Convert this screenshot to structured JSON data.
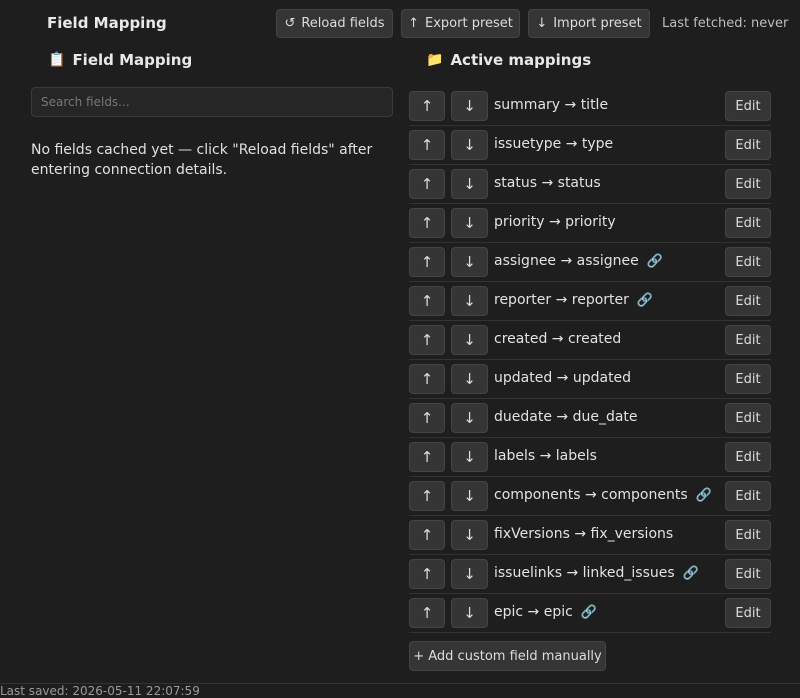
{
  "toolbar": {
    "title": "Field Mapping",
    "reload": {
      "icon": "↺",
      "label": "Reload fields"
    },
    "export": {
      "icon": "↑",
      "label": "Export preset"
    },
    "import": {
      "icon": "↓",
      "label": "Import preset"
    },
    "last_fetched": "Last fetched: never"
  },
  "left": {
    "icon": "📋",
    "title": "Field Mapping",
    "search_placeholder": "Search fields...",
    "empty_message": "No fields cached yet — click \"Reload fields\" after entering connection details."
  },
  "right": {
    "icon": "📁",
    "title": "Active mappings",
    "up_label": "↑",
    "down_label": "↓",
    "edit_label": "Edit",
    "link_icon": "🔗",
    "mappings": [
      {
        "label": "summary → title",
        "linked": false
      },
      {
        "label": "issuetype → type",
        "linked": false
      },
      {
        "label": "status → status",
        "linked": false
      },
      {
        "label": "priority → priority",
        "linked": false
      },
      {
        "label": "assignee → assignee",
        "linked": true
      },
      {
        "label": "reporter → reporter",
        "linked": true
      },
      {
        "label": "created → created",
        "linked": false
      },
      {
        "label": "updated → updated",
        "linked": false
      },
      {
        "label": "duedate → due_date",
        "linked": false
      },
      {
        "label": "labels → labels",
        "linked": false
      },
      {
        "label": "components → components",
        "linked": true
      },
      {
        "label": "fixVersions → fix_versions",
        "linked": false
      },
      {
        "label": "issuelinks → linked_issues",
        "linked": true
      },
      {
        "label": "epic → epic",
        "linked": true
      }
    ],
    "add_label": "+ Add custom field manually"
  },
  "footer": {
    "text": "Last saved: 2026-05-11 22:07:59"
  }
}
